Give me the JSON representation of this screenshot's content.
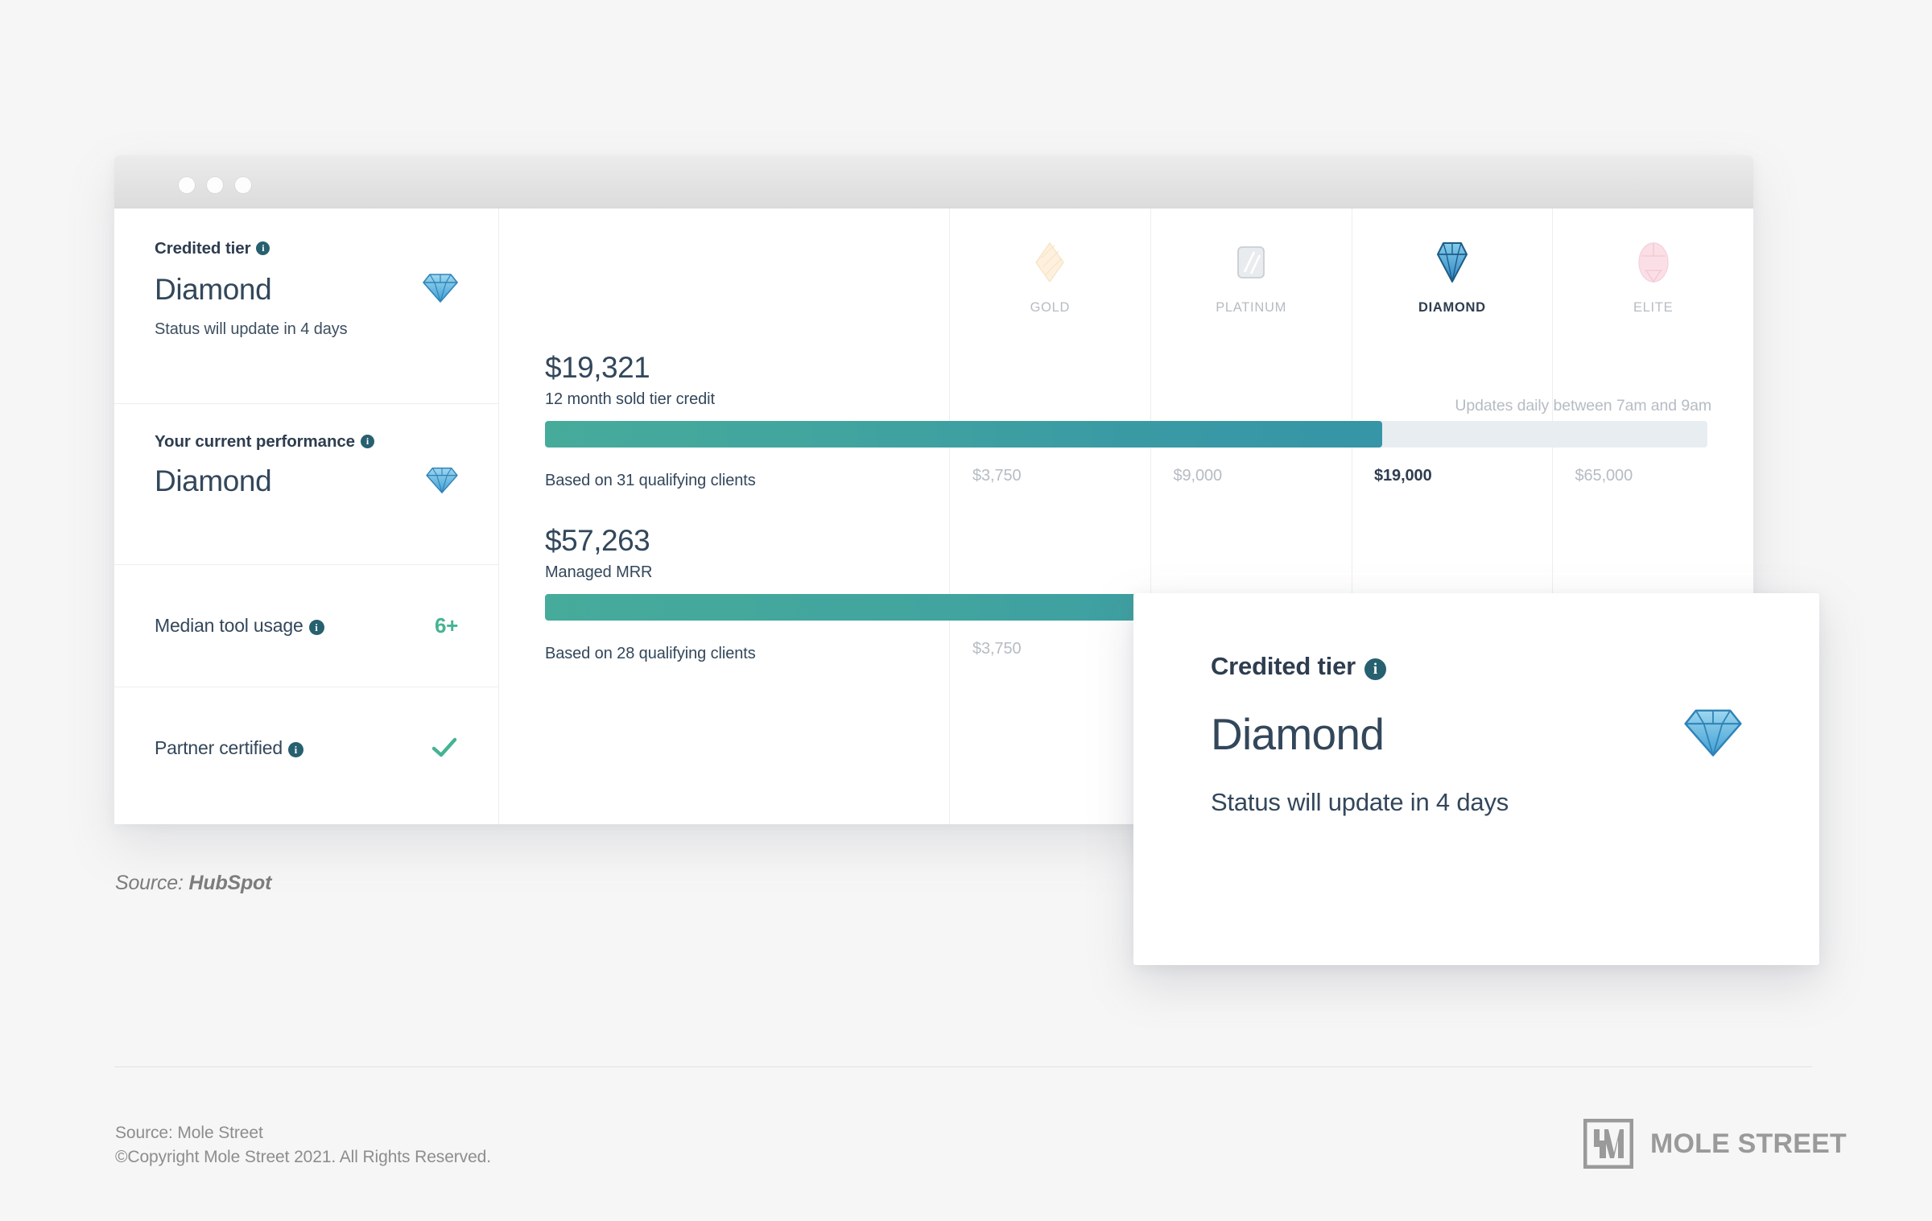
{
  "window": {
    "dots": [
      "close-dot",
      "minimize-dot",
      "maximize-dot"
    ]
  },
  "sidebar": {
    "credited": {
      "label": "Credited tier",
      "info_icon": "info-icon",
      "value": "Diamond",
      "badge_icon": "diamond-gem-icon",
      "status": "Status will update in 4 days"
    },
    "performance": {
      "label": "Your current performance",
      "info_icon": "info-icon",
      "value": "Diamond",
      "badge_icon": "diamond-gem-icon"
    },
    "tool_usage": {
      "label": "Median tool usage",
      "info_icon": "info-icon",
      "value": "6+"
    },
    "certified": {
      "label": "Partner certified",
      "info_icon": "info-icon",
      "value_icon": "check-icon"
    }
  },
  "tiers": [
    {
      "name": "GOLD",
      "icon": "gold-gem-icon",
      "current": false
    },
    {
      "name": "PLATINUM",
      "icon": "platinum-gem-icon",
      "current": false
    },
    {
      "name": "DIAMOND",
      "icon": "diamond-gem-icon",
      "current": true
    },
    {
      "name": "ELITE",
      "icon": "elite-gem-icon",
      "current": true
    }
  ],
  "metrics": [
    {
      "amount": "$19,321",
      "caption": "12 month sold tier credit",
      "note": "Updates daily between 7am and 9am",
      "based_on": "Based on 31 qualifying clients",
      "thresholds": [
        "$3,750",
        "$9,000",
        "$19,000",
        "$65,000"
      ]
    },
    {
      "amount": "$57,263",
      "caption": "Managed MRR",
      "note": "",
      "based_on": "Based on 28 qualifying clients",
      "thresholds": [
        "$3,750",
        "",
        "",
        ""
      ]
    }
  ],
  "callout": {
    "label": "Credited tier",
    "info_icon": "info-icon",
    "value": "Diamond",
    "badge_icon": "diamond-gem-icon",
    "status": "Status will update in 4 days"
  },
  "source_note": {
    "prefix": "Source: ",
    "name": "HubSpot"
  },
  "footer": {
    "line1": "Source: Mole Street",
    "line2": "©Copyright Mole Street 2021. All Rights Reserved.",
    "logo_text": "MOLE STREET"
  },
  "chart_data": {
    "type": "bar",
    "title": "HubSpot Solutions Partner tier progress",
    "series": [
      {
        "name": "12 month sold tier credit",
        "value": 19321,
        "value_label": "$19,321",
        "fill_percent": 72,
        "qualifying_clients": 31
      },
      {
        "name": "Managed MRR",
        "value": 57263,
        "value_label": "$57,263",
        "fill_percent": 100,
        "qualifying_clients": 28
      }
    ],
    "tier_thresholds": {
      "categories": [
        "GOLD",
        "PLATINUM",
        "DIAMOND",
        "ELITE"
      ],
      "sold_tier_credit": [
        3750,
        9000,
        19000,
        65000
      ],
      "managed_mrr": [
        3750,
        null,
        null,
        null
      ]
    },
    "current_tier": "DIAMOND",
    "grid": true,
    "legend": "none"
  },
  "colors": {
    "bar_start": "#46ab9b",
    "bar_end": "#3695a6",
    "bar_track": "#e8edf2",
    "accent_green": "#45b394",
    "text_dark": "#33475b",
    "text_muted": "#b6bcc3",
    "info_badge": "#27606f"
  }
}
